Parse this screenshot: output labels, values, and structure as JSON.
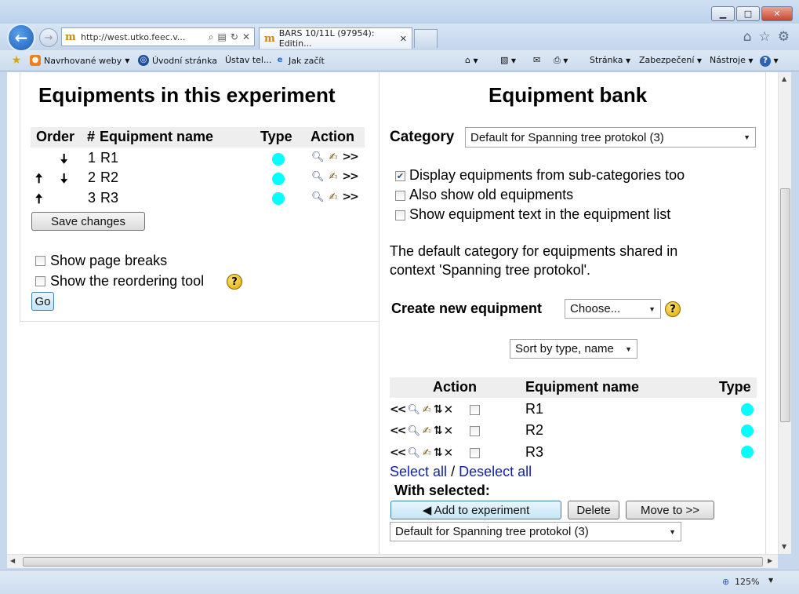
{
  "browser": {
    "address": "http://west.utko.feec.v...",
    "tab_title": "BARS 10/11L (97954): Editin...",
    "favorites": {
      "suggested": "Navrhované weby",
      "home": "Úvodní stránka",
      "ustav": "Ústav tel...",
      "jak": "Jak začít"
    },
    "commands": {
      "page": "Stránka",
      "security": "Zabezpečení",
      "tools": "Nástroje"
    },
    "zoom": "125%"
  },
  "left": {
    "title": "Equipments in this experiment",
    "headers": {
      "order": "Order",
      "num": "#",
      "name": "Equipment name",
      "type": "Type",
      "action": "Action"
    },
    "rows": [
      {
        "num": "1",
        "name": "R1"
      },
      {
        "num": "2",
        "name": "R2"
      },
      {
        "num": "3",
        "name": "R3"
      }
    ],
    "save_button": "Save changes",
    "show_page_breaks": "Show page breaks",
    "show_reorder": "Show the reordering tool",
    "go_button": "Go"
  },
  "right": {
    "title": "Equipment bank",
    "category_label": "Category",
    "category_value": "Default for Spanning tree protokol (3)",
    "opt_subcats": "Display equipments from sub-categories too",
    "opt_old": "Also show old equipments",
    "opt_text": "Show equipment text in the equipment list",
    "description_line1": "The default category for equipments shared in",
    "description_line2": "context 'Spanning tree protokol'.",
    "create_label": "Create new equipment",
    "create_select": "Choose...",
    "sort_select": "Sort by type, name",
    "headers": {
      "action": "Action",
      "name": "Equipment name",
      "type": "Type"
    },
    "rows": [
      {
        "name": "R1"
      },
      {
        "name": "R2"
      },
      {
        "name": "R3"
      }
    ],
    "select_all": "Select all",
    "separator": "/",
    "deselect_all": "Deselect all",
    "with_selected": "With selected:",
    "add_button": "◀ Add to experiment",
    "delete_button": "Delete",
    "move_button": "Move to >>",
    "target_category": "Default for Spanning tree protokol (3)"
  },
  "colors": {
    "type_dot": "#00ffff",
    "link": "#1122aa"
  }
}
